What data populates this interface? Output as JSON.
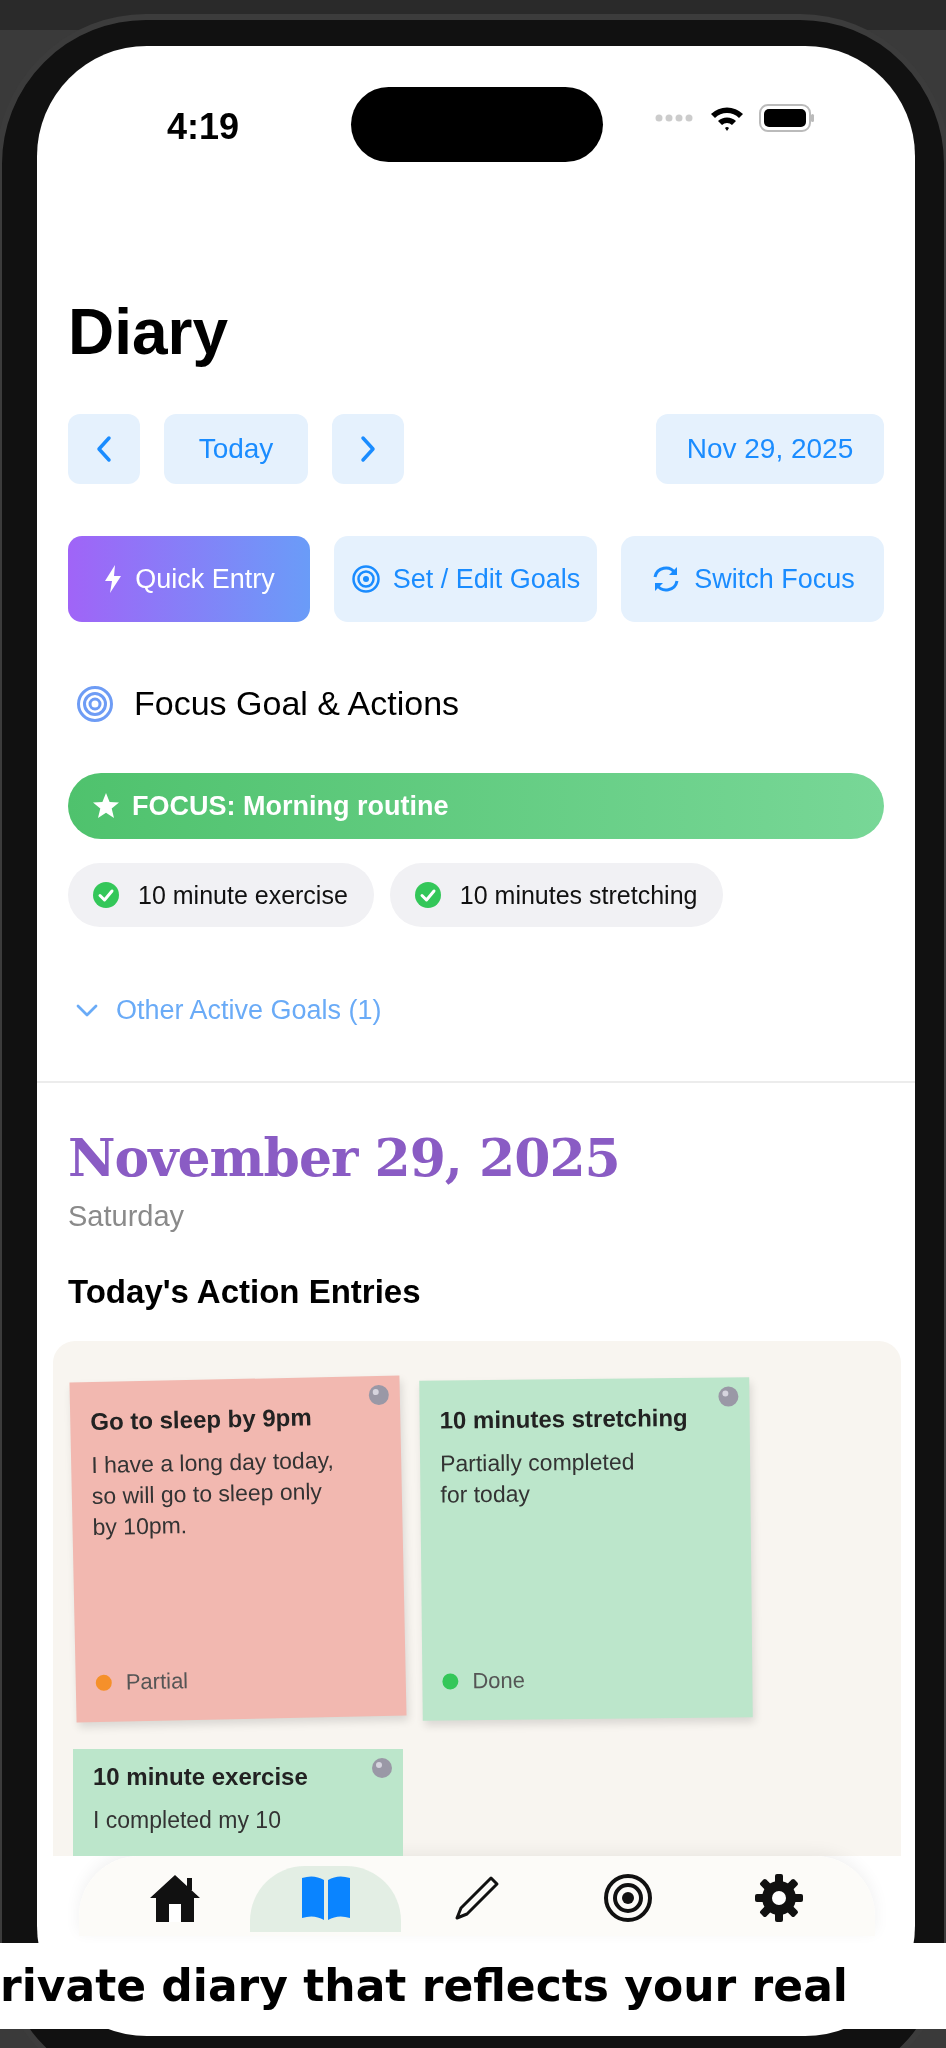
{
  "status_bar": {
    "time": "4:19"
  },
  "header": {
    "title": "Diary"
  },
  "date_nav": {
    "today": "Today",
    "date": "Nov 29, 2025"
  },
  "actions": [
    {
      "label": "Quick Entry",
      "kind": "primary"
    },
    {
      "label": "Set / Edit Goals",
      "kind": "goals"
    },
    {
      "label": "Switch Focus",
      "kind": "switch"
    }
  ],
  "focus_section": {
    "heading": "Focus Goal & Actions",
    "focus": "FOCUS: Morning routine",
    "chips": [
      {
        "label": "10 minute exercise",
        "checked": true
      },
      {
        "label": "10 minutes stretching",
        "checked": true
      }
    ],
    "other_goals": {
      "label": "Other Active Goals (1)",
      "expanded": false
    }
  },
  "day": {
    "date": "November 29, 2025",
    "weekday": "Saturday",
    "entries_heading": "Today's Action Entries"
  },
  "notes": [
    {
      "title": "Go to sleep by 9pm",
      "body": "I have a long day today,\nso will go to sleep only\nby 10pm.",
      "status": {
        "label": "Partial",
        "color": "#f5902a"
      },
      "color": "#f2b8b0"
    },
    {
      "title": "10 minutes stretching",
      "body": "Partially completed\nfor today",
      "status": {
        "label": "Done",
        "color": "#34c759"
      },
      "color": "#bce6cb"
    },
    {
      "title": "10 minute exercise",
      "body": "I completed my 10",
      "color": "#bce6cb"
    }
  ],
  "tab_bar": [
    {
      "selected": false
    },
    {
      "selected": true
    },
    {
      "selected": false
    },
    {
      "selected": false
    },
    {
      "selected": false
    }
  ],
  "caption": "rivate diary that reflects your real"
}
